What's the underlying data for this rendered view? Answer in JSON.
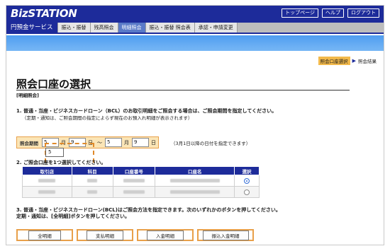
{
  "brand": {
    "name": "BizSTATION"
  },
  "top_links": [
    "トップページ",
    "ヘルプ",
    "ログアウト"
  ],
  "nav": {
    "primary": "円預金サービス",
    "tabs": [
      "振込・振替",
      "残高照会",
      "明細照会",
      "振込・振替 照会表",
      "承認・申請変更"
    ],
    "active_index": 2
  },
  "steps": {
    "current": "照会口座選択",
    "next": "照会結果"
  },
  "page": {
    "title": "照会口座の選択",
    "subtitle": "[明細照会]"
  },
  "section1": {
    "heading": "1. 普通・当座・ビジネスカードローン（BCL）のお取引明細をご照会する場合は、ご照会期間を指定してください。",
    "note": "（定期・通知は、ご照会期間の指定によらず現在のお預入れ明細が表示されます）"
  },
  "period": {
    "label": "照会期間",
    "from_month": "5",
    "from_day": "9",
    "to_month": "5",
    "to_day": "9",
    "month_unit": "月",
    "day_unit": "日",
    "tilde": "〜",
    "note": "（3月1日以降の日付を指定できます）",
    "dropdown_value": "5"
  },
  "section2": {
    "heading": "2. ご照会口座を1つ選択してください。"
  },
  "table": {
    "headers": [
      "取引店",
      "科目",
      "口座番号",
      "口座名",
      "選択"
    ],
    "rows": [
      {
        "selected": true
      },
      {
        "selected": false
      }
    ]
  },
  "section3": {
    "line1": "3. 普通・当座・ビジネスカードローン(BCL)はご照会方法を指定できます。次のいずれかのボタンを押してください。",
    "line2": "定期・通知は、[全明細]ボタンを押してください。"
  },
  "buttons": [
    "全明細",
    "支払明細",
    "入金明細",
    "振込入金明細"
  ],
  "colors": {
    "header_blue": "#1d2b9a",
    "strip_blue": "#4f9df0",
    "highlight_orange": "#e8a04a",
    "period_bg": "#fbe5b6"
  }
}
